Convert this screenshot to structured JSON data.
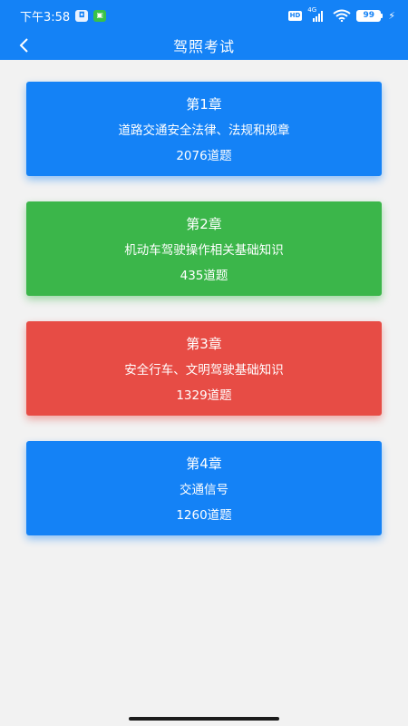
{
  "status_bar": {
    "time": "下午3:58",
    "network": "4G",
    "hd": "HD",
    "battery": "99"
  },
  "header": {
    "title": "驾照考试",
    "back_icon": "chevron-left-icon"
  },
  "chapters": [
    {
      "chapter": "第1章",
      "title": "道路交通安全法律、法规和规章",
      "count": "2076道题",
      "color": "#1482f6"
    },
    {
      "chapter": "第2章",
      "title": "机动车驾驶操作相关基础知识",
      "count": "435道题",
      "color": "#3bb64a"
    },
    {
      "chapter": "第3章",
      "title": "安全行车、文明驾驶基础知识",
      "count": "1329道题",
      "color": "#e74c45"
    },
    {
      "chapter": "第4章",
      "title": "交通信号",
      "count": "1260道题",
      "color": "#1482f6"
    }
  ]
}
